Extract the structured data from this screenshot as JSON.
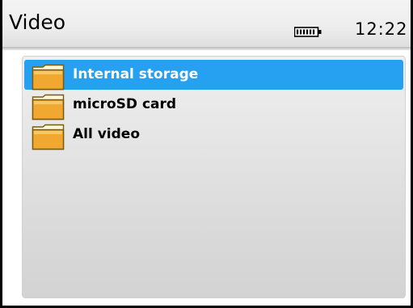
{
  "header": {
    "title": "Video",
    "clock": "12:22",
    "battery_icon": "battery-full-icon"
  },
  "folders": [
    {
      "label": "Internal storage",
      "icon": "folder-icon",
      "selected": true
    },
    {
      "label": "microSD card",
      "icon": "folder-icon",
      "selected": false
    },
    {
      "label": "All video",
      "icon": "folder-icon",
      "selected": false
    }
  ],
  "colors": {
    "selection": "#26a0f0",
    "folder": "#f0a830"
  }
}
